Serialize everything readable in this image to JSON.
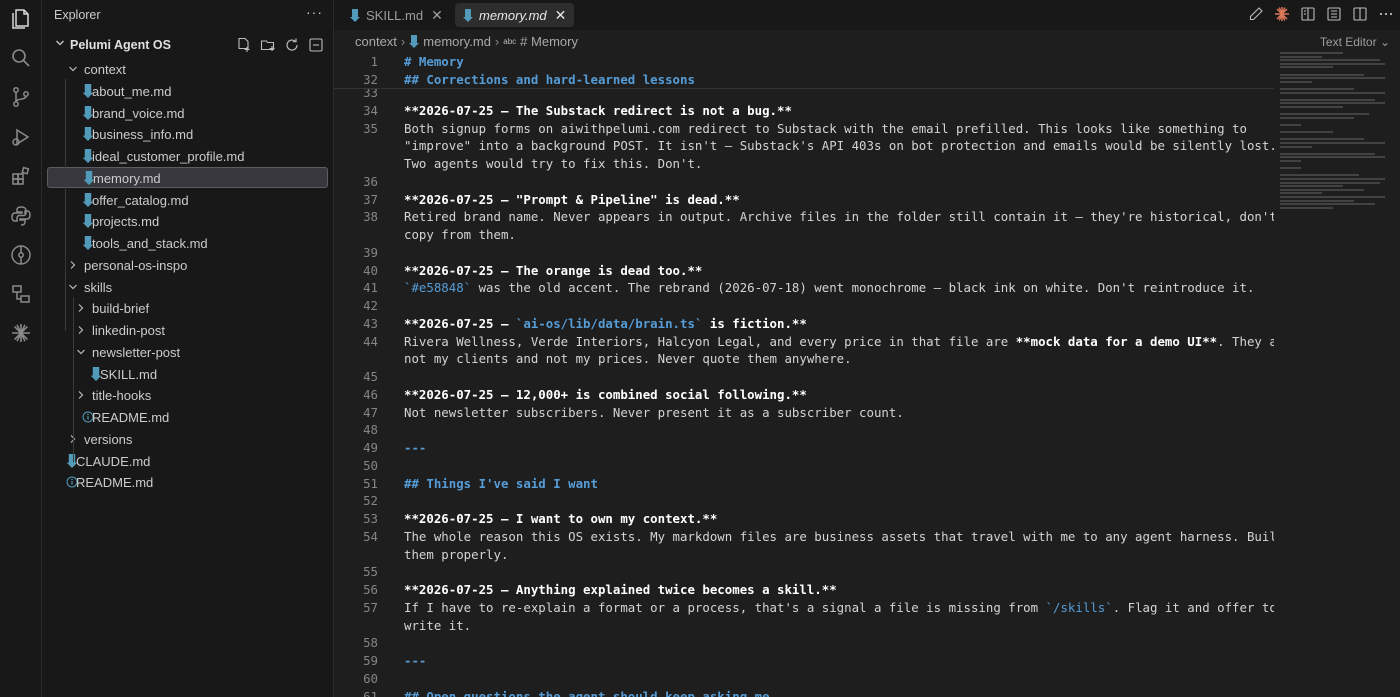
{
  "sidebar": {
    "title": "Explorer",
    "more": "···",
    "workspace": "Pelumi Agent OS",
    "tree": [
      {
        "label": "context",
        "type": "folder",
        "open": true
      },
      {
        "label": "about_me.md",
        "type": "md"
      },
      {
        "label": "brand_voice.md",
        "type": "md"
      },
      {
        "label": "business_info.md",
        "type": "md"
      },
      {
        "label": "ideal_customer_profile.md",
        "type": "md"
      },
      {
        "label": "memory.md",
        "type": "md",
        "selected": true
      },
      {
        "label": "offer_catalog.md",
        "type": "md"
      },
      {
        "label": "projects.md",
        "type": "md"
      },
      {
        "label": "tools_and_stack.md",
        "type": "md"
      },
      {
        "label": "personal-os-inspo",
        "type": "folder",
        "open": false
      },
      {
        "label": "skills",
        "type": "folder",
        "open": true
      },
      {
        "label": "build-brief",
        "type": "folder",
        "open": false
      },
      {
        "label": "linkedin-post",
        "type": "folder",
        "open": false
      },
      {
        "label": "newsletter-post",
        "type": "folder",
        "open": true
      },
      {
        "label": "SKILL.md",
        "type": "md"
      },
      {
        "label": "title-hooks",
        "type": "folder",
        "open": false
      },
      {
        "label": "README.md",
        "type": "info"
      },
      {
        "label": "versions",
        "type": "folder",
        "open": false
      },
      {
        "label": "CLAUDE.md",
        "type": "md"
      },
      {
        "label": "README.md",
        "type": "info"
      }
    ]
  },
  "tabs": [
    {
      "label": "SKILL.md",
      "active": false,
      "close": "✕"
    },
    {
      "label": "memory.md",
      "active": true,
      "close": "✕"
    }
  ],
  "breadcrumb": {
    "folder": "context",
    "file": "memory.md",
    "symbol_prefix": "abc",
    "symbol": "# Memory"
  },
  "editor_mode": "Text Editor",
  "sticky": [
    {
      "num": "1",
      "text": "# Memory"
    },
    {
      "num": "32",
      "text": "## Corrections and hard-learned lessons"
    }
  ],
  "lines": [
    {
      "num": "33",
      "text": ""
    },
    {
      "num": "34",
      "text": "**2026-07-25 — The Substack redirect is not a bug.**"
    },
    {
      "num": "35",
      "text": "Both signup forms on aiwithpelumi.com redirect to Substack with the email prefilled. This looks like something to"
    },
    {
      "num": "",
      "text": "\"improve\" into a background POST. It isn't — Substack's API 403s on bot protection and emails would be silently lost."
    },
    {
      "num": "",
      "text": "Two agents would try to fix this. Don't."
    },
    {
      "num": "36",
      "text": ""
    },
    {
      "num": "37",
      "text": "**2026-07-25 — \"Prompt & Pipeline\" is dead.**"
    },
    {
      "num": "38",
      "text": "Retired brand name. Never appears in output. Archive files in the folder still contain it — they're historical, don't"
    },
    {
      "num": "",
      "text": "copy from them."
    },
    {
      "num": "39",
      "text": ""
    },
    {
      "num": "40",
      "text": "**2026-07-25 — The orange is dead too.**"
    },
    {
      "num": "41",
      "text": "`#e58848` was the old accent. The rebrand (2026-07-18) went monochrome — black ink on white. Don't reintroduce it."
    },
    {
      "num": "42",
      "text": ""
    },
    {
      "num": "43",
      "text": "**2026-07-25 — `ai-os/lib/data/brain.ts` is fiction.**"
    },
    {
      "num": "44",
      "text": "Rivera Wellness, Verde Interiors, Halcyon Legal, and every price in that file are **mock data for a demo UI**. They are"
    },
    {
      "num": "",
      "text": "not my clients and not my prices. Never quote them anywhere."
    },
    {
      "num": "45",
      "text": ""
    },
    {
      "num": "46",
      "text": "**2026-07-25 — 12,000+ is combined social following.**"
    },
    {
      "num": "47",
      "text": "Not newsletter subscribers. Never present it as a subscriber count."
    },
    {
      "num": "48",
      "text": ""
    },
    {
      "num": "49",
      "text": "---"
    },
    {
      "num": "50",
      "text": ""
    },
    {
      "num": "51",
      "text": "## Things I've said I want"
    },
    {
      "num": "52",
      "text": ""
    },
    {
      "num": "53",
      "text": "**2026-07-25 — I want to own my context.**"
    },
    {
      "num": "54",
      "text": "The whole reason this OS exists. My markdown files are business assets that travel with me to any agent harness. Build"
    },
    {
      "num": "",
      "text": "them properly."
    },
    {
      "num": "55",
      "text": ""
    },
    {
      "num": "56",
      "text": "**2026-07-25 — Anything explained twice becomes a skill.**"
    },
    {
      "num": "57",
      "text": "If I have to re-explain a format or a process, that's a signal a file is missing from `/skills`. Flag it and offer to"
    },
    {
      "num": "",
      "text": "write it."
    },
    {
      "num": "58",
      "text": ""
    },
    {
      "num": "59",
      "text": "---"
    },
    {
      "num": "60",
      "text": ""
    },
    {
      "num": "61",
      "text": "## Open questions the agent should keep asking me"
    }
  ],
  "colors": {
    "accent": "#569cd6",
    "md_icon": "#519aba",
    "claude": "#d97757"
  }
}
